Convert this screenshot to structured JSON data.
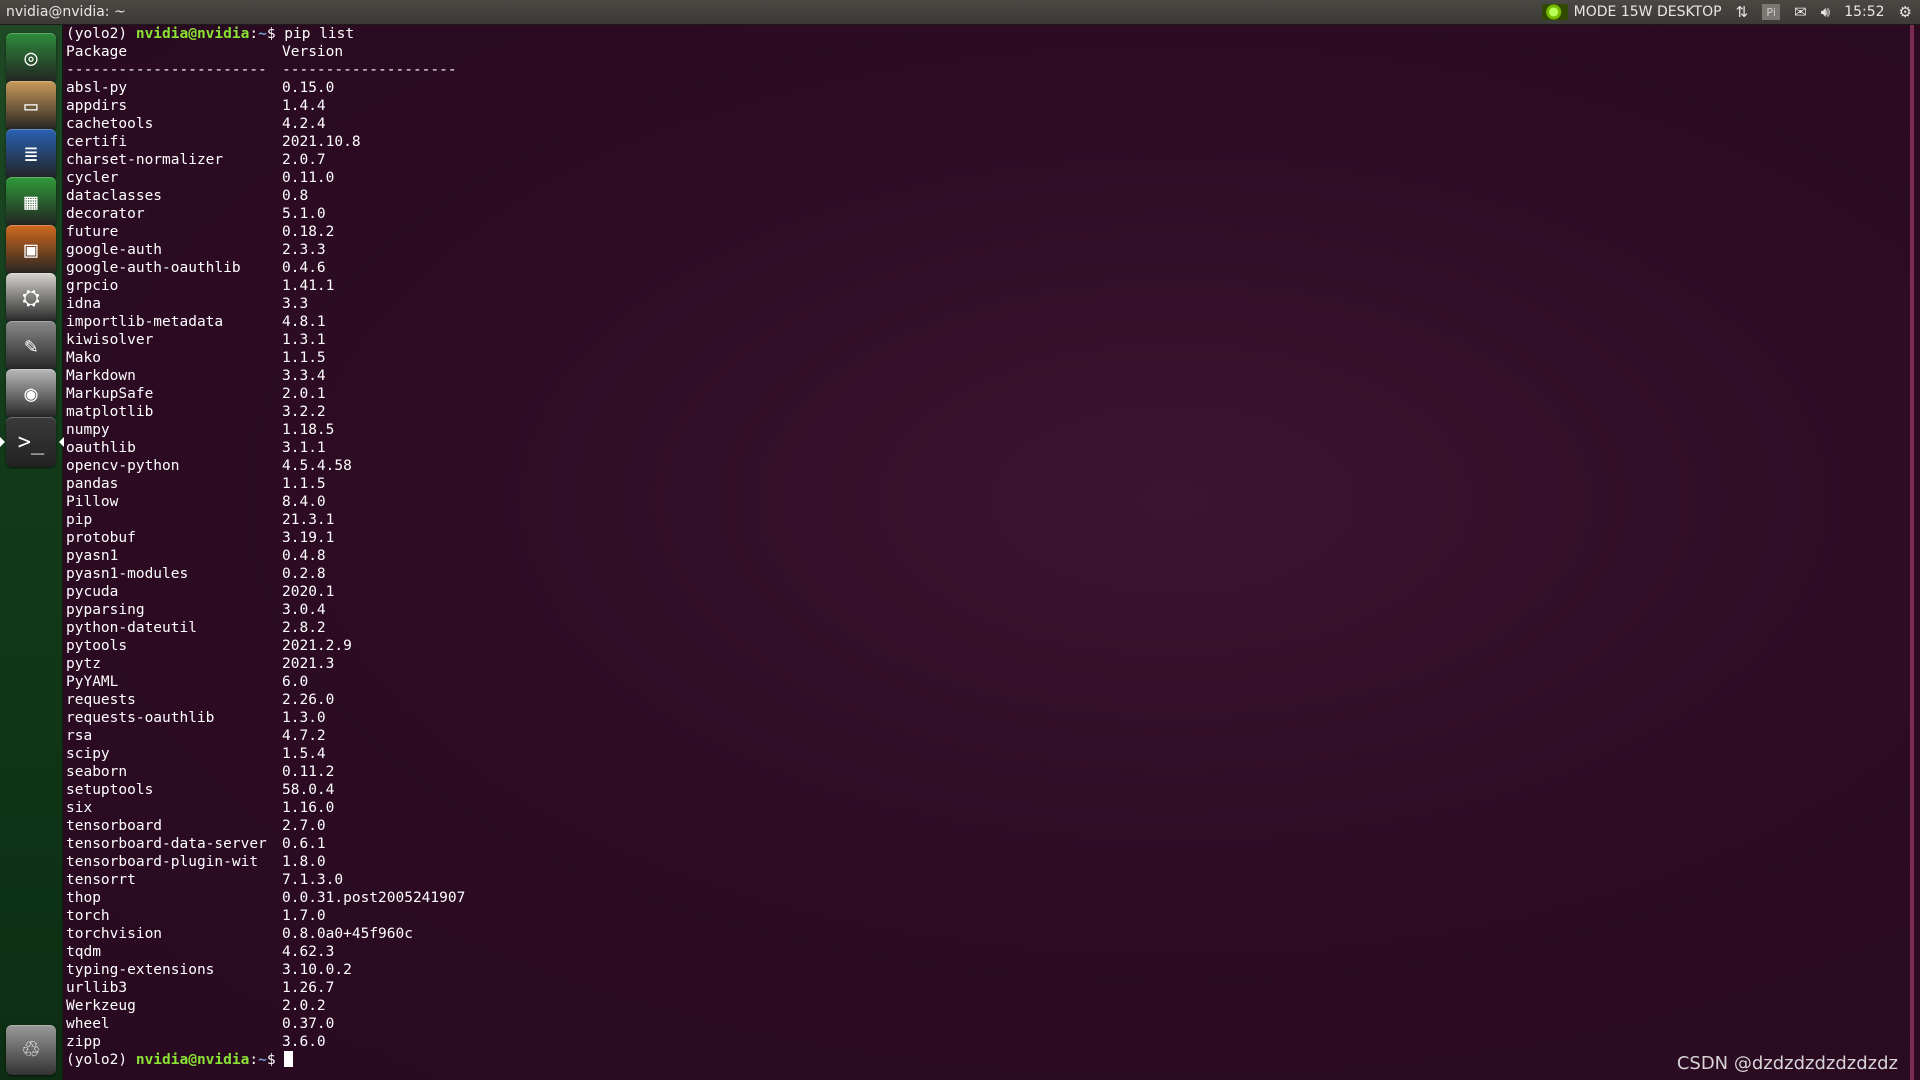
{
  "topbar": {
    "window_title": "nvidia@nvidia: ~",
    "power_mode": "MODE 15W DESKTOP",
    "time": "15:52",
    "icons": [
      "nvidia-logo-icon",
      "network-icon",
      "pi-icon",
      "mail-icon",
      "volume-icon",
      "gear-icon"
    ]
  },
  "launcher": {
    "items": [
      {
        "name": "ubuntu-dash-icon",
        "color": "#2e8b3a",
        "glyph": "◎"
      },
      {
        "name": "files-icon",
        "color": "#c99a5a",
        "glyph": "▭"
      },
      {
        "name": "writer-icon",
        "color": "#2a62b3",
        "glyph": "≣"
      },
      {
        "name": "calc-icon",
        "color": "#2f9a3a",
        "glyph": "▦"
      },
      {
        "name": "impress-icon",
        "color": "#d2691e",
        "glyph": "▣"
      },
      {
        "name": "software-center-icon",
        "color": "#d6d4cf",
        "glyph": "⛭"
      },
      {
        "name": "system-settings-icon",
        "color": "#8a8a8a",
        "glyph": "✎"
      },
      {
        "name": "camera-icon",
        "color": "#b9b9b9",
        "glyph": "◉"
      },
      {
        "name": "terminal-icon",
        "color": "#3a3a3a",
        "glyph": ">_"
      }
    ],
    "trash": {
      "name": "trash-icon",
      "color": "#9a9a9a",
      "glyph": "♲"
    }
  },
  "terminal": {
    "prompt_env": "(yolo2) ",
    "prompt_user": "nvidia@nvidia",
    "prompt_sep": ":",
    "prompt_path": "~",
    "prompt_end": "$ ",
    "command": "pip list",
    "header_package": "Package",
    "header_version": "Version",
    "separator_package": "-----------------------",
    "separator_version": "--------------------",
    "packages": [
      {
        "name": "absl-py",
        "version": "0.15.0"
      },
      {
        "name": "appdirs",
        "version": "1.4.4"
      },
      {
        "name": "cachetools",
        "version": "4.2.4"
      },
      {
        "name": "certifi",
        "version": "2021.10.8"
      },
      {
        "name": "charset-normalizer",
        "version": "2.0.7"
      },
      {
        "name": "cycler",
        "version": "0.11.0"
      },
      {
        "name": "dataclasses",
        "version": "0.8"
      },
      {
        "name": "decorator",
        "version": "5.1.0"
      },
      {
        "name": "future",
        "version": "0.18.2"
      },
      {
        "name": "google-auth",
        "version": "2.3.3"
      },
      {
        "name": "google-auth-oauthlib",
        "version": "0.4.6"
      },
      {
        "name": "grpcio",
        "version": "1.41.1"
      },
      {
        "name": "idna",
        "version": "3.3"
      },
      {
        "name": "importlib-metadata",
        "version": "4.8.1"
      },
      {
        "name": "kiwisolver",
        "version": "1.3.1"
      },
      {
        "name": "Mako",
        "version": "1.1.5"
      },
      {
        "name": "Markdown",
        "version": "3.3.4"
      },
      {
        "name": "MarkupSafe",
        "version": "2.0.1"
      },
      {
        "name": "matplotlib",
        "version": "3.2.2"
      },
      {
        "name": "numpy",
        "version": "1.18.5"
      },
      {
        "name": "oauthlib",
        "version": "3.1.1"
      },
      {
        "name": "opencv-python",
        "version": "4.5.4.58"
      },
      {
        "name": "pandas",
        "version": "1.1.5"
      },
      {
        "name": "Pillow",
        "version": "8.4.0"
      },
      {
        "name": "pip",
        "version": "21.3.1"
      },
      {
        "name": "protobuf",
        "version": "3.19.1"
      },
      {
        "name": "pyasn1",
        "version": "0.4.8"
      },
      {
        "name": "pyasn1-modules",
        "version": "0.2.8"
      },
      {
        "name": "pycuda",
        "version": "2020.1"
      },
      {
        "name": "pyparsing",
        "version": "3.0.4"
      },
      {
        "name": "python-dateutil",
        "version": "2.8.2"
      },
      {
        "name": "pytools",
        "version": "2021.2.9"
      },
      {
        "name": "pytz",
        "version": "2021.3"
      },
      {
        "name": "PyYAML",
        "version": "6.0"
      },
      {
        "name": "requests",
        "version": "2.26.0"
      },
      {
        "name": "requests-oauthlib",
        "version": "1.3.0"
      },
      {
        "name": "rsa",
        "version": "4.7.2"
      },
      {
        "name": "scipy",
        "version": "1.5.4"
      },
      {
        "name": "seaborn",
        "version": "0.11.2"
      },
      {
        "name": "setuptools",
        "version": "58.0.4"
      },
      {
        "name": "six",
        "version": "1.16.0"
      },
      {
        "name": "tensorboard",
        "version": "2.7.0"
      },
      {
        "name": "tensorboard-data-server",
        "version": "0.6.1"
      },
      {
        "name": "tensorboard-plugin-wit",
        "version": "1.8.0"
      },
      {
        "name": "tensorrt",
        "version": "7.1.3.0"
      },
      {
        "name": "thop",
        "version": "0.0.31.post2005241907"
      },
      {
        "name": "torch",
        "version": "1.7.0"
      },
      {
        "name": "torchvision",
        "version": "0.8.0a0+45f960c"
      },
      {
        "name": "tqdm",
        "version": "4.62.3"
      },
      {
        "name": "typing-extensions",
        "version": "3.10.0.2"
      },
      {
        "name": "urllib3",
        "version": "1.26.7"
      },
      {
        "name": "Werkzeug",
        "version": "2.0.2"
      },
      {
        "name": "wheel",
        "version": "0.37.0"
      },
      {
        "name": "zipp",
        "version": "3.6.0"
      }
    ]
  },
  "watermark": "CSDN @dzdzdzdzdzdzdz"
}
